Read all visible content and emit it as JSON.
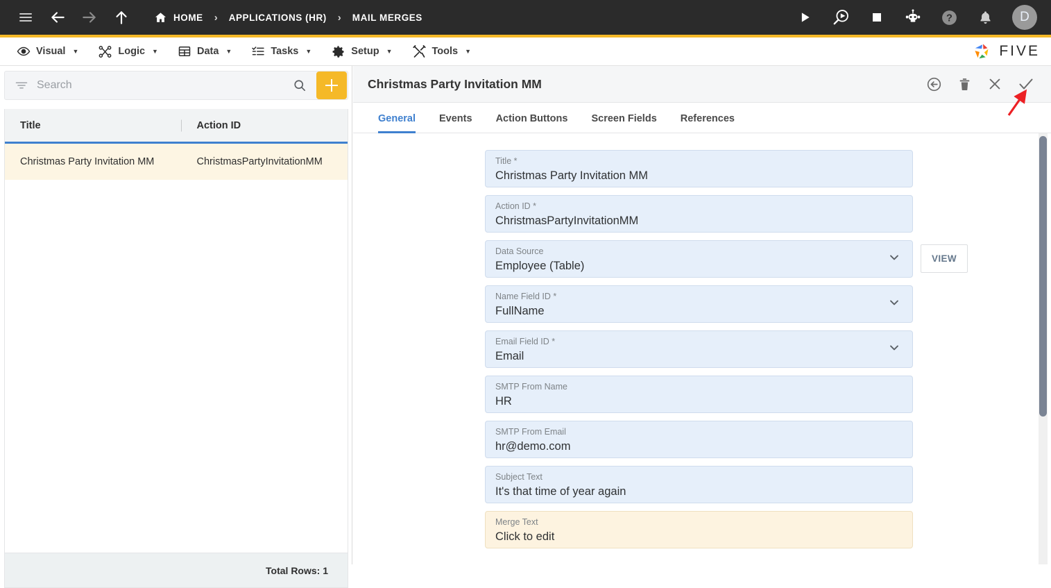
{
  "topbar": {
    "nav_icons": [
      {
        "name": "hamburger-menu-icon",
        "label": "Menu"
      },
      {
        "name": "back-arrow-icon",
        "label": "Back"
      },
      {
        "name": "forward-arrow-icon",
        "label": "Forward"
      },
      {
        "name": "up-arrow-icon",
        "label": "Up"
      }
    ],
    "breadcrumbs": [
      {
        "label": "HOME",
        "icon": "home-icon"
      },
      {
        "label": "APPLICATIONS (HR)",
        "icon": ""
      },
      {
        "label": "MAIL MERGES",
        "icon": ""
      }
    ],
    "separator": "›",
    "right_icons": [
      {
        "name": "run-play-icon",
        "label": "Run"
      },
      {
        "name": "debug-search-play-icon",
        "label": "Debug"
      },
      {
        "name": "stop-square-icon",
        "label": "Stop"
      },
      {
        "name": "chatbot-robot-icon",
        "label": "Assistant"
      },
      {
        "name": "help-question-icon",
        "label": "Help"
      },
      {
        "name": "notification-bell-icon",
        "label": "Notifications"
      }
    ],
    "avatar_initial": "D",
    "accent_color": "#f5b928",
    "background_color": "#2b2b2b"
  },
  "menubar": {
    "items": [
      {
        "label": "Visual",
        "icon": "eye-icon",
        "caret": "▼"
      },
      {
        "label": "Logic",
        "icon": "logic-nodes-icon",
        "caret": "▼"
      },
      {
        "label": "Data",
        "icon": "table-grid-icon",
        "caret": "▼"
      },
      {
        "label": "Tasks",
        "icon": "checklist-icon",
        "caret": "▼"
      },
      {
        "label": "Setup",
        "icon": "gear-icon",
        "caret": "▼"
      },
      {
        "label": "Tools",
        "icon": "tools-wrench-icon",
        "caret": "▼"
      }
    ],
    "brand_text": "FIVE",
    "brand_colors": [
      "#4285f4",
      "#ea4335",
      "#fbbc04",
      "#34a853",
      "#ff8c00"
    ]
  },
  "sidebar": {
    "search": {
      "placeholder": "Search",
      "value": "",
      "filter_icon": "filter-icon",
      "search_icon": "search-icon"
    },
    "add_button": {
      "label": "+",
      "name": "add-record-button",
      "color": "#f5b928"
    },
    "grid": {
      "columns": [
        "Title",
        "Action ID"
      ],
      "rows": [
        {
          "title": "Christmas Party Invitation MM",
          "action_id": "ChristmasPartyInvitationMM",
          "selected": true
        }
      ],
      "footer": "Total Rows: 1",
      "selected_row_color": "#fdf5e3",
      "header_underline_color": "#3f80cf"
    }
  },
  "detail": {
    "title": "Christmas Party Invitation MM",
    "header_actions": [
      {
        "name": "undo-back-circle-icon",
        "label": "Revert"
      },
      {
        "name": "delete-trash-icon",
        "label": "Delete"
      },
      {
        "name": "close-x-icon",
        "label": "Close"
      },
      {
        "name": "save-check-icon",
        "label": "Save"
      }
    ],
    "tabs": [
      {
        "label": "General",
        "active": true
      },
      {
        "label": "Events",
        "active": false
      },
      {
        "label": "Action Buttons",
        "active": false
      },
      {
        "label": "Screen Fields",
        "active": false
      },
      {
        "label": "References",
        "active": false
      }
    ],
    "active_tab_color": "#3f80cf",
    "fields": [
      {
        "label": "Title *",
        "value": "Christmas Party Invitation MM",
        "type": "text",
        "name": "title-field"
      },
      {
        "label": "Action ID *",
        "value": "ChristmasPartyInvitationMM",
        "type": "text",
        "name": "action-id-field"
      },
      {
        "label": "Data Source",
        "value": "Employee (Table)",
        "type": "select",
        "name": "data-source-field",
        "side_button": "VIEW"
      },
      {
        "label": "Name Field ID *",
        "value": "FullName",
        "type": "select",
        "name": "name-field-id-field"
      },
      {
        "label": "Email Field ID *",
        "value": "Email",
        "type": "select",
        "name": "email-field-id-field"
      },
      {
        "label": "SMTP From Name",
        "value": "HR",
        "type": "text",
        "name": "smtp-from-name-field"
      },
      {
        "label": "SMTP From Email",
        "value": "hr@demo.com",
        "type": "text",
        "name": "smtp-from-email-field"
      },
      {
        "label": "Subject Text",
        "value": "It's that time of year again",
        "type": "text",
        "name": "subject-text-field"
      },
      {
        "label": "Merge Text",
        "value": "Click to edit",
        "type": "text",
        "name": "merge-text-field",
        "highlight": true
      }
    ],
    "annotation": {
      "type": "arrow",
      "color": "#ec2024",
      "points_to": "save-check-icon"
    }
  }
}
